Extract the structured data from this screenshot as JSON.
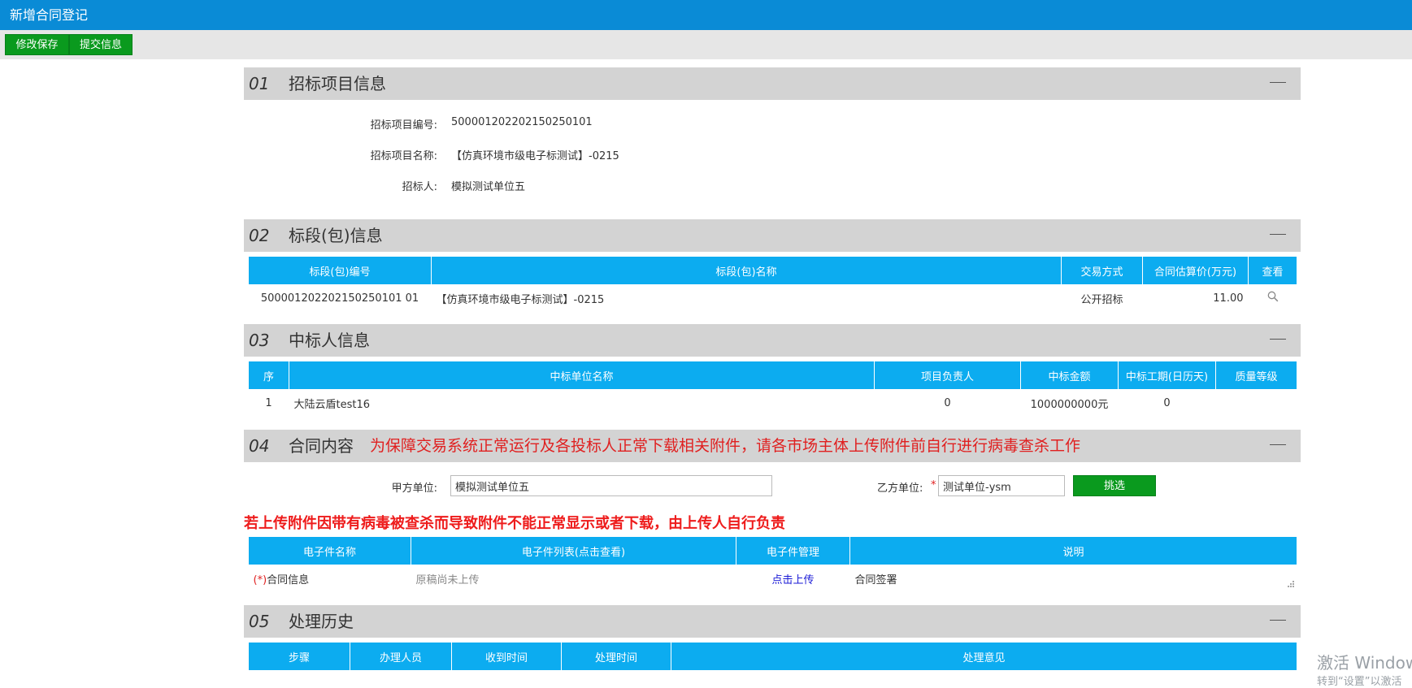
{
  "window": {
    "title": "新增合同登记"
  },
  "toolbar": {
    "save_label": "修改保存",
    "submit_label": "提交信息"
  },
  "section1": {
    "num": "01",
    "title": "招标项目信息",
    "fields": [
      {
        "label": "招标项目编号:",
        "value": "500001202202150250101"
      },
      {
        "label": "招标项目名称:",
        "value": "【仿真环境市级电子标测试】-0215"
      },
      {
        "label": "招标人:",
        "value": "模拟测试单位五"
      }
    ]
  },
  "section2": {
    "num": "02",
    "title": "标段(包)信息",
    "headers": [
      "标段(包)编号",
      "标段(包)名称",
      "交易方式",
      "合同估算价(万元)",
      "查看"
    ],
    "rows": [
      {
        "code": "500001202202150250101 01",
        "name": "【仿真环境市级电子标测试】-0215",
        "method": "公开招标",
        "price": "11.00"
      }
    ]
  },
  "section3": {
    "num": "03",
    "title": "中标人信息",
    "headers": [
      "序",
      "中标单位名称",
      "项目负责人",
      "中标金额",
      "中标工期(日历天)",
      "质量等级"
    ],
    "rows": [
      {
        "seq": "1",
        "name": "大陆云盾test16",
        "manager": "0",
        "amount": "1000000000元",
        "period": "0",
        "quality": ""
      }
    ]
  },
  "section4": {
    "num": "04",
    "title": "合同内容",
    "warning": "为保障交易系统正常运行及各投标人正常下载相关附件，请各市场主体上传附件前自行进行病毒查杀工作",
    "party_a_label": "甲方单位:",
    "party_a_value": "模拟测试单位五",
    "party_b_label": "乙方单位:",
    "party_b_required": "*",
    "party_b_value": "测试单位-ysm",
    "pick_label": "挑选",
    "notice": "若上传附件因带有病毒被查杀而导致附件不能正常显示或者下载，由上传人自行负责",
    "headers": [
      "电子件名称",
      "电子件列表(点击查看)",
      "电子件管理",
      "说明"
    ],
    "rows": [
      {
        "required": "(*)",
        "name": "合同信息",
        "list": "原稿尚未上传",
        "action": "点击上传",
        "desc": "合同签署"
      }
    ]
  },
  "section5": {
    "num": "05",
    "title": "处理历史",
    "headers": [
      "步骤",
      "办理人员",
      "收到时间",
      "处理时间",
      "处理意见"
    ]
  },
  "watermark": {
    "line1": "激活 Windows",
    "line2": "转到“设置”以激活"
  },
  "colors": {
    "titlebar": "#0a8bd6",
    "table_header": "#0cacf0",
    "button_green": "#0a9a1e",
    "warning_red": "#e02020",
    "link_blue": "#1a1ad6"
  }
}
